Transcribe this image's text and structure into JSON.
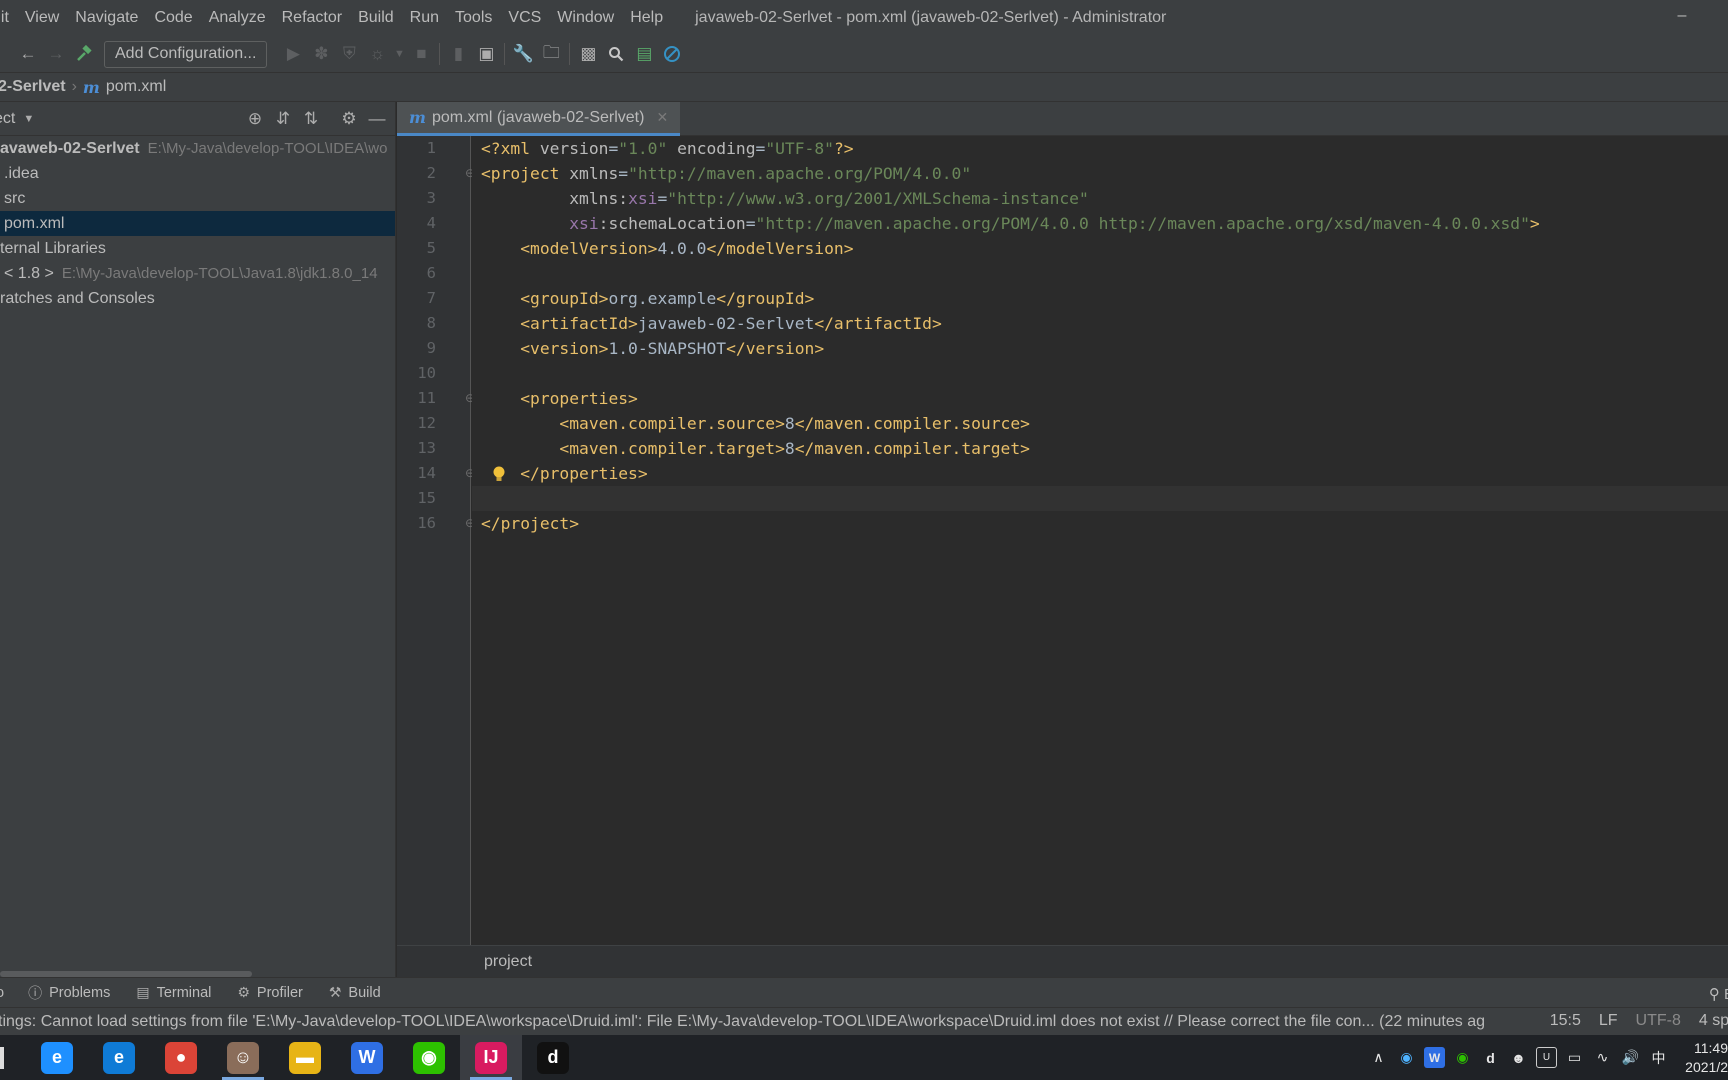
{
  "window": {
    "title": "javaweb-02-Serlvet - pom.xml (javaweb-02-Serlvet) - Administrator",
    "minimize": "–"
  },
  "menu": [
    "dit",
    "View",
    "Navigate",
    "Code",
    "Analyze",
    "Refactor",
    "Build",
    "Run",
    "Tools",
    "VCS",
    "Window",
    "Help"
  ],
  "toolbar": {
    "add_configuration": "Add Configuration...",
    "icons": [
      "back-arrow-icon",
      "forward-arrow-icon",
      "build-hammer-icon",
      "run-icon",
      "debug-icon",
      "coverage-icon",
      "profile-icon",
      "stop-icon",
      "vcs-icon",
      "project-structure-icon",
      "settings-wrench-icon",
      "open-folder-icon",
      "terminal-icon",
      "search-icon",
      "monitor-icon",
      "no-entry-icon"
    ]
  },
  "breadcrumb": {
    "project": "2-Serlvet",
    "file": "pom.xml",
    "m_badge": "m"
  },
  "project_panel": {
    "header": "ect",
    "tree": [
      {
        "label": "avaweb-02-Serlvet",
        "path": "E:\\My-Java\\develop-TOOL\\IDEA\\wo",
        "bold": true
      },
      {
        "label": ".idea",
        "path": ""
      },
      {
        "label": "src",
        "path": ""
      },
      {
        "label": "pom.xml",
        "path": "",
        "selected": true
      },
      {
        "label": "ternal Libraries",
        "path": ""
      },
      {
        "label": "< 1.8 >",
        "path": "E:\\My-Java\\develop-TOOL\\Java1.8\\jdk1.8.0_14"
      },
      {
        "label": "ratches and Consoles",
        "path": ""
      }
    ]
  },
  "editor": {
    "tab_label": "pom.xml (javaweb-02-Serlvet)",
    "current_line": 15,
    "lines": [
      [
        [
          "t-tag",
          "<?xml "
        ],
        [
          "t-attr",
          "version"
        ],
        [
          "t-txt",
          "="
        ],
        [
          "t-str",
          "\"1.0\""
        ],
        [
          "t-txt",
          " "
        ],
        [
          "t-attr",
          "encoding"
        ],
        [
          "t-txt",
          "="
        ],
        [
          "t-str",
          "\"UTF-8\""
        ],
        [
          "t-tag",
          "?>"
        ]
      ],
      [
        [
          "t-tag",
          "<project "
        ],
        [
          "t-attr",
          "xmlns"
        ],
        [
          "t-txt",
          "="
        ],
        [
          "t-str",
          "\"http://maven.apache.org/POM/4.0.0\""
        ]
      ],
      [
        [
          "t-txt",
          "         "
        ],
        [
          "t-attr",
          "xmlns:"
        ],
        [
          "t-ns",
          "xsi"
        ],
        [
          "t-txt",
          "="
        ],
        [
          "t-str",
          "\"http://www.w3.org/2001/XMLSchema-instance\""
        ]
      ],
      [
        [
          "t-txt",
          "         "
        ],
        [
          "t-ns",
          "xsi"
        ],
        [
          "t-attr",
          ":schemaLocation"
        ],
        [
          "t-txt",
          "="
        ],
        [
          "t-str",
          "\"http://maven.apache.org/POM/4.0.0 http://maven.apache.org/xsd/maven-4.0.0.xsd\""
        ],
        [
          "t-tag",
          ">"
        ]
      ],
      [
        [
          "t-txt",
          "    "
        ],
        [
          "t-tag",
          "<modelVersion>"
        ],
        [
          "t-txt",
          "4.0.0"
        ],
        [
          "t-tag",
          "</modelVersion>"
        ]
      ],
      [],
      [
        [
          "t-txt",
          "    "
        ],
        [
          "t-tag",
          "<groupId>"
        ],
        [
          "t-txt",
          "org.example"
        ],
        [
          "t-tag",
          "</groupId>"
        ]
      ],
      [
        [
          "t-txt",
          "    "
        ],
        [
          "t-tag",
          "<artifactId>"
        ],
        [
          "t-txt",
          "javaweb-02-Serlvet"
        ],
        [
          "t-tag",
          "</artifactId>"
        ]
      ],
      [
        [
          "t-txt",
          "    "
        ],
        [
          "t-tag",
          "<version>"
        ],
        [
          "t-txt",
          "1.0-SNAPSHOT"
        ],
        [
          "t-tag",
          "</version>"
        ]
      ],
      [],
      [
        [
          "t-txt",
          "    "
        ],
        [
          "t-tag",
          "<properties>"
        ]
      ],
      [
        [
          "t-txt",
          "        "
        ],
        [
          "t-tag",
          "<maven.compiler.source>"
        ],
        [
          "t-txt",
          "8"
        ],
        [
          "t-tag",
          "</maven.compiler.source>"
        ]
      ],
      [
        [
          "t-txt",
          "        "
        ],
        [
          "t-tag",
          "<maven.compiler.target>"
        ],
        [
          "t-txt",
          "8"
        ],
        [
          "t-tag",
          "</maven.compiler.target>"
        ]
      ],
      [
        [
          "t-txt",
          "    "
        ],
        [
          "t-tag",
          "</properties>"
        ]
      ],
      [],
      [
        [
          "t-tag",
          "</project>"
        ]
      ]
    ],
    "fold_lines": [
      2,
      11,
      14,
      16
    ],
    "bulb_line": 14,
    "breadcrumb": "project"
  },
  "tool_strip": {
    "items": [
      {
        "icon": "problems-icon",
        "label": "Problems"
      },
      {
        "icon": "terminal-icon",
        "label": "Terminal"
      },
      {
        "icon": "profiler-icon",
        "label": "Profiler"
      },
      {
        "icon": "build-icon",
        "label": "Build"
      }
    ],
    "left_glyph": "o"
  },
  "status": {
    "message": "tings: Cannot load settings from file 'E:\\My-Java\\develop-TOOL\\IDEA\\workspace\\Druid.iml': File E:\\My-Java\\develop-TOOL\\IDEA\\workspace\\Druid.iml does not exist // Please correct the file con... (22 minutes ag",
    "position": "15:5",
    "line_sep": "LF",
    "encoding": "UTF-8",
    "indent": "4 spa"
  },
  "taskbar": {
    "apps": [
      {
        "name": "ie-app",
        "label": "e",
        "color": "#1e90ff"
      },
      {
        "name": "edge-app",
        "label": "e",
        "color": "#0f7bd6"
      },
      {
        "name": "chrome-app",
        "label": "●",
        "color": "#db4437"
      },
      {
        "name": "avatar-app",
        "label": "☺",
        "color": "#8a6d5a"
      },
      {
        "name": "explorer-app",
        "label": "▬",
        "color": "#e7b416"
      },
      {
        "name": "wps-app",
        "label": "W",
        "color": "#2f6fe4"
      },
      {
        "name": "wechat-app",
        "label": "◉",
        "color": "#2dc100"
      },
      {
        "name": "intellij-app",
        "label": "IJ",
        "color": "#d81b60"
      },
      {
        "name": "dingtalk-app",
        "label": "d",
        "color": "#111111"
      }
    ],
    "tray_ime": "中",
    "clock_time": "11:49",
    "clock_date": "2021/2"
  }
}
